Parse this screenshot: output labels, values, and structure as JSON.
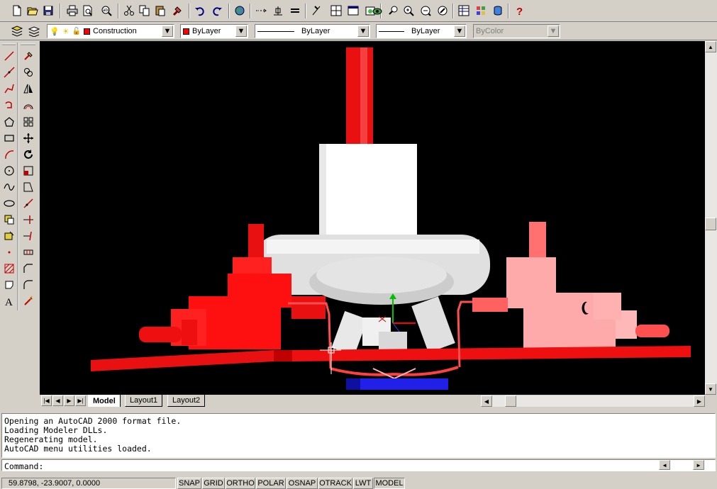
{
  "toolbar": {
    "icons": [
      "new-icon",
      "open-icon",
      "save-icon",
      "print-icon",
      "print-preview-icon",
      "spell-check-icon",
      "cut-icon",
      "copy-icon",
      "paste-icon",
      "match-properties-icon",
      "undo-icon",
      "redo-icon",
      "web-icon",
      "insert-hyperlink-icon",
      "object-snap-icon",
      "ucs-icon",
      "distance-icon",
      "tiled-viewport-icon",
      "properties-icon",
      "today-icon",
      "pan-icon",
      "zoom-realtime-icon",
      "zoom-window-icon",
      "zoom-previous-icon",
      "properties-table-icon",
      "design-center-icon",
      "db-connect-icon",
      "help-icon"
    ]
  },
  "layers": {
    "current_layer": "Construction",
    "color": "ByLayer",
    "linetype": "ByLayer",
    "lineweight": "ByLayer",
    "plotstyle": "ByColor",
    "accent_color": "#ff0000"
  },
  "draw_tools": [
    "line-icon",
    "construction-line-icon",
    "polyline-icon",
    "polygon-icon",
    "rectangle-icon",
    "arc-icon",
    "circle-icon",
    "spline-icon",
    "ellipse-icon",
    "insert-block-icon",
    "make-block-icon",
    "point-icon",
    "hatch-icon",
    "region-icon",
    "multiline-text-icon"
  ],
  "modify_tools": [
    "erase-icon",
    "copy-object-icon",
    "mirror-icon",
    "offset-icon",
    "array-icon",
    "move-icon",
    "rotate-icon",
    "scale-icon",
    "stretch-icon",
    "lengthen-icon",
    "trim-icon",
    "extend-icon",
    "break-icon",
    "chamfer-icon",
    "fillet-icon",
    "explode-icon"
  ],
  "tabs": {
    "model": "Model",
    "layout1": "Layout1",
    "layout2": "Layout2"
  },
  "command": {
    "history": [
      "Opening an AutoCAD 2000 format file.",
      "Loading Modeler DLLs.",
      "Regenerating model.",
      "AutoCAD menu utilities loaded."
    ],
    "prompt": "Command:"
  },
  "status": {
    "coords": "59.8798, -23.9007, 0.0000",
    "snap": "SNAP",
    "grid": "GRID",
    "ortho": "ORTHO",
    "polar": "POLAR",
    "osnap": "OSNAP",
    "otrack": "OTRACK",
    "lwt": "LWT",
    "model": "MODEL"
  }
}
